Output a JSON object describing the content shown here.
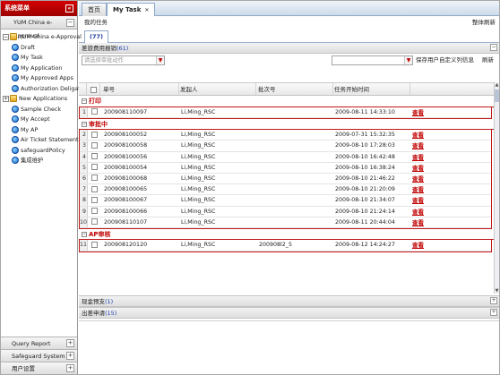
{
  "sidebar": {
    "header": "系统菜单",
    "module": "YUM China e-Approval",
    "tree": [
      {
        "label": "YUM China e-Approval",
        "level": 0,
        "type": "folder",
        "expanded": true
      },
      {
        "label": "Draft",
        "level": 1,
        "type": "leaf"
      },
      {
        "label": "My Task",
        "level": 1,
        "type": "leaf"
      },
      {
        "label": "My Application",
        "level": 1,
        "type": "leaf"
      },
      {
        "label": "My Approved Apps",
        "level": 1,
        "type": "leaf"
      },
      {
        "label": "Authorization Deligati",
        "level": 1,
        "type": "leaf"
      },
      {
        "label": "New Applications",
        "level": 0,
        "type": "folder",
        "expanded": false
      },
      {
        "label": "Sample Check",
        "level": 1,
        "type": "leaf"
      },
      {
        "label": "My Accept",
        "level": 1,
        "type": "leaf"
      },
      {
        "label": "My AP",
        "level": 1,
        "type": "leaf"
      },
      {
        "label": "Air Ticket Statement",
        "level": 1,
        "type": "leaf"
      },
      {
        "label": "safeguardPolicy",
        "level": 1,
        "type": "leaf"
      },
      {
        "label": "集成维护",
        "level": 1,
        "type": "leaf"
      }
    ],
    "panels": [
      "Query Report",
      "Safeguard System",
      "用户设置"
    ]
  },
  "tabs": [
    {
      "label": "首页",
      "active": false
    },
    {
      "label": "My Task",
      "active": true
    }
  ],
  "page_title": "我的任务",
  "refresh_all": "整体刷新",
  "subtab_label": "(77)",
  "section": {
    "name": "差旅费用报销",
    "count": "(61)"
  },
  "toolbar": {
    "filter_placeholder": "请选择审批动作",
    "save_filter": "保存用户自定义列信息",
    "refresh": "刷新"
  },
  "columns": [
    "单号",
    "发起人",
    "批次号",
    "任务开始时间"
  ],
  "groups": [
    {
      "name": "打印",
      "rows": [
        {
          "n": "1",
          "no": "200908110097",
          "by": "Li,Ming_RSC",
          "batch": "",
          "time": "2009-08-11 14:33:10",
          "action": "查看"
        }
      ]
    },
    {
      "name": "审批中",
      "rows": [
        {
          "n": "2",
          "no": "200908100052",
          "by": "Li,Ming_RSC",
          "batch": "",
          "time": "2009-07-31 15:32:35",
          "action": "查看"
        },
        {
          "n": "3",
          "no": "200908100058",
          "by": "Li,Ming_RSC",
          "batch": "",
          "time": "2009-08-10 17:28:03",
          "action": "查看"
        },
        {
          "n": "4",
          "no": "200908100056",
          "by": "Li,Ming_RSC",
          "batch": "",
          "time": "2009-08-10 16:42:48",
          "action": "查看"
        },
        {
          "n": "5",
          "no": "200908100054",
          "by": "Li,Ming_RSC",
          "batch": "",
          "time": "2009-08-10 16:38:24",
          "action": "查看"
        },
        {
          "n": "6",
          "no": "200908100068",
          "by": "Li,Ming_RSC",
          "batch": "",
          "time": "2009-08-10 21:46:22",
          "action": "查看"
        },
        {
          "n": "7",
          "no": "200908100065",
          "by": "Li,Ming_RSC",
          "batch": "",
          "time": "2009-08-10 21:20:09",
          "action": "查看"
        },
        {
          "n": "8",
          "no": "200908100067",
          "by": "Li,Ming_RSC",
          "batch": "",
          "time": "2009-08-10 21:34:07",
          "action": "查看"
        },
        {
          "n": "9",
          "no": "200908100066",
          "by": "Li,Ming_RSC",
          "batch": "",
          "time": "2009-08-10 21:24:14",
          "action": "查看"
        },
        {
          "n": "10",
          "no": "200908110107",
          "by": "Li,Ming_RSC",
          "batch": "",
          "time": "2009-08-11 20:44:04",
          "action": "查看"
        }
      ]
    },
    {
      "name": "AP审核",
      "rows": [
        {
          "n": "11",
          "no": "200908120120",
          "by": "Li,Ming_RSC",
          "batch": "200908l2_5",
          "time": "2009-08-12 14:24:27",
          "action": "查看"
        }
      ]
    }
  ],
  "bottom_sections": [
    {
      "name": "现金预支",
      "count": "(1)"
    },
    {
      "name": "出差申请",
      "count": "(15)"
    }
  ]
}
